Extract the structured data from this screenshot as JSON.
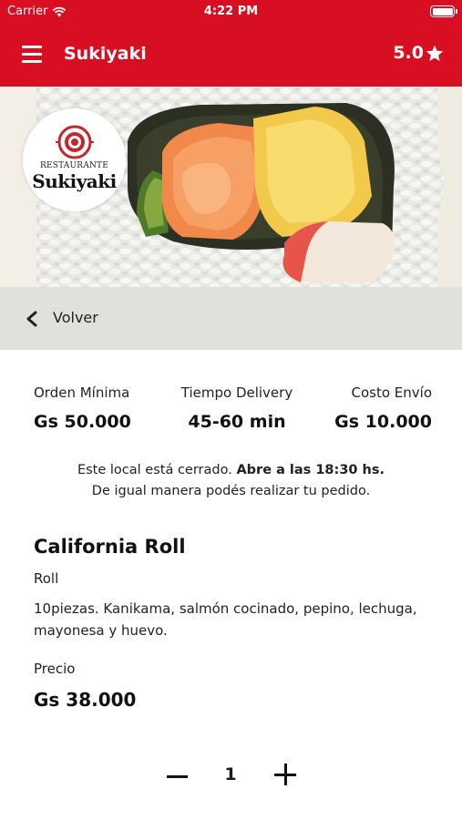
{
  "status_bar": {
    "carrier": "Carrier",
    "time": "4:22 PM"
  },
  "navbar": {
    "title": "Sukiyaki",
    "rating": "5.0"
  },
  "restaurant_logo": {
    "line1": "RESTAURANTE",
    "line2": "Sukiyaki"
  },
  "back": {
    "label": "Volver"
  },
  "info": {
    "min_order": {
      "label": "Orden Mínima",
      "value": "Gs 50.000"
    },
    "delivery_time": {
      "label": "Tiempo Delivery",
      "value": "45-60 min"
    },
    "shipping_cost": {
      "label": "Costo Envío",
      "value": "Gs 10.000"
    }
  },
  "notice": {
    "closed": "Este local está cerrado.",
    "opens": "Abre a las 18:30 hs.",
    "line2": "De igual manera podés realizar tu pedido."
  },
  "product": {
    "name": "California Roll",
    "category": "Roll",
    "description": "10piezas. Kanikama, salmón cocinado, pepino, lechuga, mayonesa y huevo.",
    "price_label": "Precio",
    "price": "Gs 38.000"
  },
  "quantity": {
    "value": "1"
  },
  "colors": {
    "brand_red": "#d80f22",
    "back_bar": "#e1e1dc"
  },
  "icons": [
    "wifi-icon",
    "battery-icon",
    "hamburger-menu-icon",
    "star-icon",
    "chevron-left-icon",
    "minus-icon",
    "plus-icon"
  ]
}
